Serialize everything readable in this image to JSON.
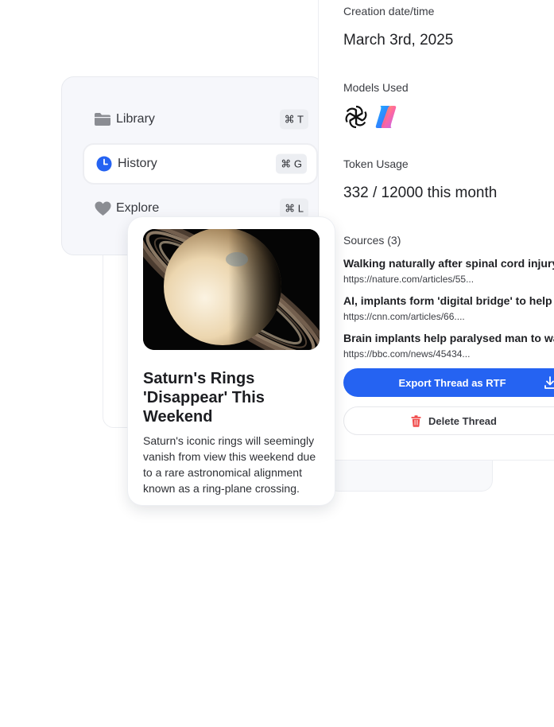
{
  "nav": {
    "items": [
      {
        "label": "Library",
        "shortcut": "⌘ T"
      },
      {
        "label": "History",
        "shortcut": "⌘ G"
      },
      {
        "label": "Explore",
        "shortcut": "⌘ L"
      }
    ]
  },
  "article": {
    "title": "Saturn's Rings 'Disappear' This Weekend",
    "description": "Saturn's iconic rings will seemingly vanish from view this weekend due to a rare astronomical alignment known as a ring-plane crossing."
  },
  "details": {
    "creation_label": "Creation date/time",
    "creation_value": "March 3rd, 2025",
    "models_label": "Models Used",
    "models": [
      {
        "icon": "openai-icon"
      },
      {
        "icon": "copilot-icon"
      }
    ],
    "token_label": "Token Usage",
    "token_value": "332 / 12000 this month",
    "sources_label": "Sources (3)",
    "sources": [
      {
        "title": "Walking naturally after spinal cord injury",
        "url": "https://nature.com/articles/55..."
      },
      {
        "title": "AI, implants form 'digital bridge' to help pa",
        "url": "https://cnn.com/articles/66...."
      },
      {
        "title": "Brain implants help paralysed man to wa",
        "url": "https://bbc.com/news/45434..."
      }
    ],
    "export_label": "Export Thread as RTF",
    "delete_label": "Delete Thread"
  },
  "colors": {
    "accent": "#2563f2",
    "danger": "#f04b4b",
    "nav_icon": "#8b8d93"
  }
}
